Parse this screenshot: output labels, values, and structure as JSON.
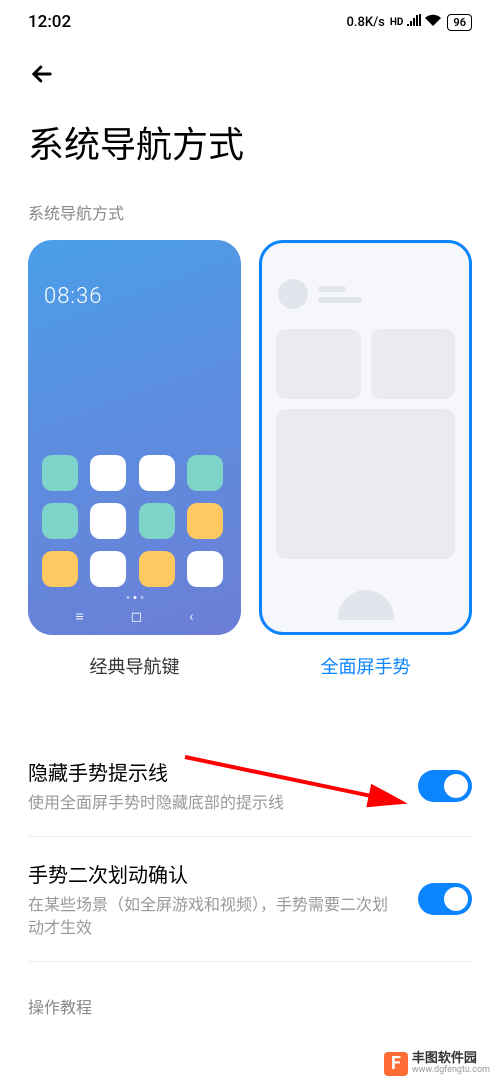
{
  "statusBar": {
    "time": "12:02",
    "speed": "0.8K/s",
    "hd": "HD",
    "battery": "96"
  },
  "page": {
    "title": "系统导航方式",
    "sectionLabel": "系统导航方式"
  },
  "navOptions": {
    "classic": {
      "label": "经典导航键",
      "previewTime": "08:36"
    },
    "gesture": {
      "label": "全面屏手势"
    }
  },
  "settings": [
    {
      "title": "隐藏手势提示线",
      "desc": "使用全面屏手势时隐藏底部的提示线",
      "enabled": true
    },
    {
      "title": "手势二次划动确认",
      "desc": "在某些场景（如全屏游戏和视频），手势需要二次划动才生效",
      "enabled": true
    }
  ],
  "tutorialLabel": "操作教程",
  "watermark": {
    "name": "丰图软件园",
    "url": "www.dgfengtu.com"
  },
  "iconColors": [
    "#7fd4c9",
    "#ffffff",
    "#ffffff",
    "#7fd4c9",
    "#7fd4c9",
    "#ffffff",
    "#7fd4c9",
    "#ffc961",
    "#ffc961",
    "#ffffff",
    "#ffc961",
    "#ffffff"
  ]
}
